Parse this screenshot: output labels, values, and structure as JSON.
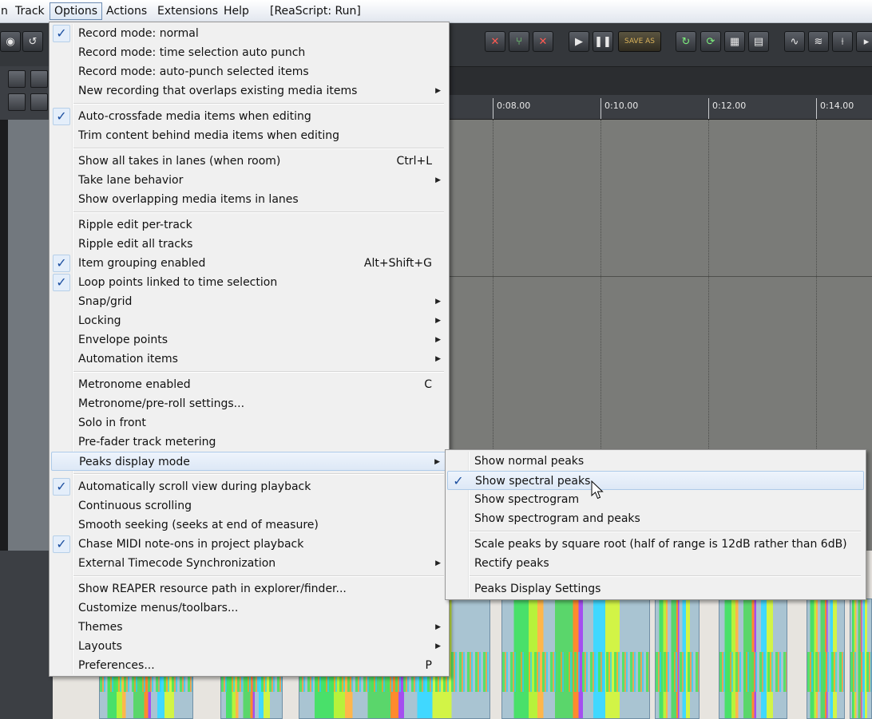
{
  "menubar": {
    "items": [
      "n",
      "Track",
      "Options",
      "Actions",
      "Extensions",
      "Help",
      "[ReaScript: Run]"
    ]
  },
  "toolbar": {
    "save_as": "SAVE AS"
  },
  "ruler": {
    "ticks": [
      "0:08.00",
      "0:10.00",
      "0:12.00",
      "0:14.00"
    ]
  },
  "options_menu": {
    "items": [
      {
        "label": "Record mode: normal",
        "checked": true
      },
      {
        "label": "Record mode: time selection auto punch"
      },
      {
        "label": "Record mode: auto-punch selected items"
      },
      {
        "label": "New recording that overlaps existing media items",
        "submenu": true
      },
      {
        "label": "Auto-crossfade media items when editing",
        "checked": true
      },
      {
        "label": "Trim content behind media items when editing"
      },
      {
        "label": "Show all takes in lanes (when room)",
        "shortcut": "Ctrl+L"
      },
      {
        "label": "Take lane behavior",
        "submenu": true
      },
      {
        "label": "Show overlapping media items in lanes"
      },
      {
        "label": "Ripple edit per-track"
      },
      {
        "label": "Ripple edit all tracks"
      },
      {
        "label": "Item grouping enabled",
        "checked": true,
        "shortcut": "Alt+Shift+G"
      },
      {
        "label": "Loop points linked to time selection",
        "checked": true
      },
      {
        "label": "Snap/grid",
        "submenu": true
      },
      {
        "label": "Locking",
        "submenu": true
      },
      {
        "label": "Envelope points",
        "submenu": true
      },
      {
        "label": "Automation items",
        "submenu": true
      },
      {
        "label": "Metronome enabled",
        "shortcut": "C"
      },
      {
        "label": "Metronome/pre-roll settings..."
      },
      {
        "label": "Solo in front"
      },
      {
        "label": "Pre-fader track metering"
      },
      {
        "label": "Peaks display mode",
        "submenu": true
      },
      {
        "label": "Automatically scroll view during playback",
        "checked": true
      },
      {
        "label": "Continuous scrolling"
      },
      {
        "label": "Smooth seeking (seeks at end of measure)"
      },
      {
        "label": "Chase MIDI note-ons in project playback",
        "checked": true
      },
      {
        "label": "External Timecode Synchronization",
        "submenu": true
      },
      {
        "label": "Show REAPER resource path in explorer/finder..."
      },
      {
        "label": "Customize menus/toolbars..."
      },
      {
        "label": "Themes",
        "submenu": true
      },
      {
        "label": "Layouts",
        "submenu": true
      },
      {
        "label": "Preferences...",
        "shortcut": "P"
      }
    ]
  },
  "peaks_submenu": {
    "items": [
      {
        "label": "Show normal peaks"
      },
      {
        "label": "Show spectral peaks",
        "checked": true
      },
      {
        "label": "Show spectrogram"
      },
      {
        "label": "Show spectrogram and peaks"
      },
      {
        "label": "Scale peaks by square root (half of range is 12dB rather than 6dB)"
      },
      {
        "label": "Rectify peaks"
      },
      {
        "label": "Peaks Display Settings"
      }
    ]
  }
}
